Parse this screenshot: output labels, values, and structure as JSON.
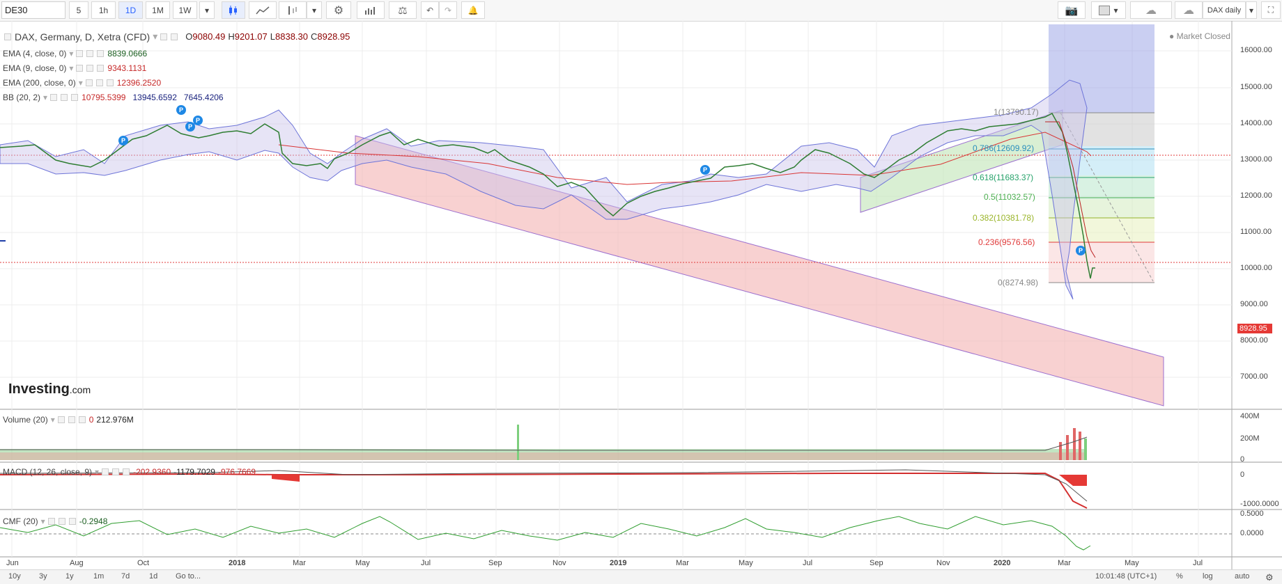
{
  "toolbar": {
    "symbol": "DE30",
    "intervals": [
      "5",
      "1h",
      "1D",
      "1M",
      "1W"
    ],
    "active_interval": "1D",
    "right_label": "DAX daily"
  },
  "legend": {
    "main_name": "DAX, Germany, D, Xetra (CFD)",
    "o_label": "O",
    "o": "9080.49",
    "h_label": "H",
    "h": "9201.07",
    "l_label": "L",
    "l": "8838.30",
    "c_label": "C",
    "c": "8928.95",
    "ema4_name": "EMA (4, close, 0)",
    "ema4_val": "8839.0666",
    "ema9_name": "EMA (9, close, 0)",
    "ema9_val": "9343.1131",
    "ema200_name": "EMA (200, close, 0)",
    "ema200_val": "12396.2520",
    "bb_name": "BB (20, 2)",
    "bb_mid": "10795.5399",
    "bb_up": "13945.6592",
    "bb_low": "7645.4206",
    "market_status": "Market Closed",
    "brand": "Investing",
    "brand_suffix": ".com"
  },
  "volume": {
    "name": "Volume (20)",
    "v1": "0",
    "v2": "212.976M"
  },
  "macd": {
    "name": "MACD (12, 26, close, 9)",
    "v1": "-202.9360",
    "v2": "-1179.7029",
    "v3": "-976.7669"
  },
  "cmf": {
    "name": "CMF (20)",
    "v1": "-0.2948"
  },
  "price_axis": [
    "16000.00",
    "15000.00",
    "14000.00",
    "13000.00",
    "12000.00",
    "11000.00",
    "10000.00",
    "9000.00",
    "8000.00",
    "7000.00"
  ],
  "last_price": "8928.95",
  "volume_axis": [
    "400M",
    "200M",
    "0"
  ],
  "macd_axis": [
    "0",
    "-1000.0000"
  ],
  "cmf_axis": [
    "0.5000",
    "0.0000"
  ],
  "time_axis": [
    "Jun",
    "Aug",
    "Oct",
    "2018",
    "Mar",
    "May",
    "Jul",
    "Sep",
    "Nov",
    "2019",
    "Mar",
    "May",
    "Jul",
    "Sep",
    "Nov",
    "2020",
    "Mar",
    "May",
    "Jul"
  ],
  "fib_levels": [
    {
      "label": "1(13790.17)",
      "color": "#888888"
    },
    {
      "label": "0.786(12609.92)",
      "color": "#2a8fbd"
    },
    {
      "label": "0.618(11683.37)",
      "color": "#27a36b"
    },
    {
      "label": "0.5(11032.57)",
      "color": "#4caf50"
    },
    {
      "label": "0.382(10381.78)",
      "color": "#9ab52a"
    },
    {
      "label": "0.236(9576.56)",
      "color": "#e03a3a"
    },
    {
      "label": "0(8274.98)",
      "color": "#888888"
    }
  ],
  "bottom": {
    "ranges": [
      "10y",
      "3y",
      "1y",
      "1m",
      "7d",
      "1d"
    ],
    "goto": "Go to...",
    "time": "10:01:48 (UTC+1)",
    "pct": "%",
    "log": "log",
    "auto": "auto"
  }
}
